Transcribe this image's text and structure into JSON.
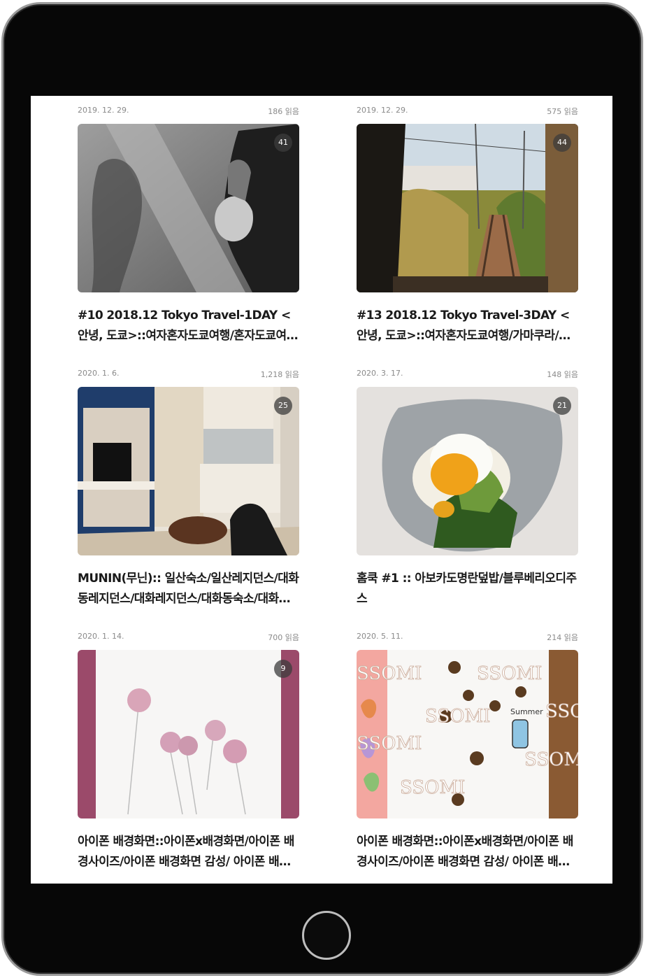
{
  "posts": [
    {
      "date": "2019. 12. 29.",
      "reads": "186 읽음",
      "photo_count": "41",
      "title": "#10 2018.12 Tokyo Travel-1DAY <안녕, 도쿄>::여자혼자도쿄여행/혼자도쿄여행/도쿄여행"
    },
    {
      "date": "2019. 12. 29.",
      "reads": "575 읽음",
      "photo_count": "44",
      "title": "#13 2018.12 Tokyo Travel-3DAY <안녕, 도쿄>::여자혼자도쿄여행/가마쿠라/에노시마/에노덴"
    },
    {
      "date": "2020. 1. 6.",
      "reads": "1,218 읽음",
      "photo_count": "25",
      "title": "MUNIN(무닌):: 일산숙소/일산레지던스/대화동레지던스/대화레지던스/대화동숙소/대화숙소"
    },
    {
      "date": "2020. 3. 17.",
      "reads": "148 읽음",
      "photo_count": "21",
      "title": "홈쿡 #1 :: 아보카도명란덮밥/블루베리오디주스"
    },
    {
      "date": "2020. 1. 14.",
      "reads": "700 읽음",
      "photo_count": "9",
      "title": "아이폰 배경화면::아이폰x배경화면/아이폰 배경사이즈/아이폰 배경화면 감성/ 아이폰 배경화면 고화질"
    },
    {
      "date": "2020. 5. 11.",
      "reads": "214 읽음",
      "photo_count": "",
      "title": "아이폰 배경화면::아이폰x배경화면/아이폰 배경사이즈/아이폰 배경화면 감성/ 아이폰 배경화면 고화질",
      "thumb_text": [
        "SSOMI",
        "SSOMI",
        "SSOMI",
        "SSOMI",
        "Summer",
        "SSOMI",
        "SSO",
        "SSOMI"
      ]
    }
  ],
  "colors": {
    "bezel": "#070707",
    "screen": "#ffffff",
    "meta_text": "#8a8a8a",
    "title_text": "#1a1a1a",
    "badge": "#3c3c3c"
  }
}
